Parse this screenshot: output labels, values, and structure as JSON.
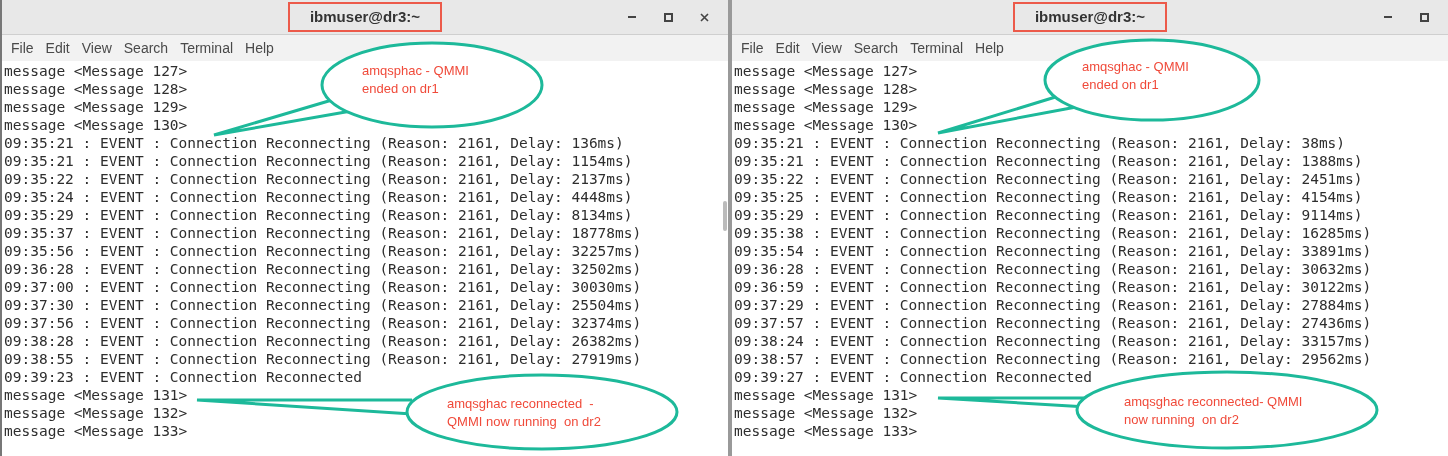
{
  "windows": [
    {
      "title": "ibmuser@dr3:~",
      "controls": [
        {
          "kind": "minimize"
        },
        {
          "kind": "maximize"
        },
        {
          "kind": "close"
        }
      ],
      "menu": [
        "File",
        "Edit",
        "View",
        "Search",
        "Terminal",
        "Help"
      ],
      "lines": [
        "message <Message 127>",
        "message <Message 128>",
        "message <Message 129>",
        "message <Message 130>",
        "09:35:21 : EVENT : Connection Reconnecting (Reason: 2161, Delay: 136ms)",
        "09:35:21 : EVENT : Connection Reconnecting (Reason: 2161, Delay: 1154ms)",
        "09:35:22 : EVENT : Connection Reconnecting (Reason: 2161, Delay: 2137ms)",
        "09:35:24 : EVENT : Connection Reconnecting (Reason: 2161, Delay: 4448ms)",
        "09:35:29 : EVENT : Connection Reconnecting (Reason: 2161, Delay: 8134ms)",
        "09:35:37 : EVENT : Connection Reconnecting (Reason: 2161, Delay: 18778ms)",
        "09:35:56 : EVENT : Connection Reconnecting (Reason: 2161, Delay: 32257ms)",
        "09:36:28 : EVENT : Connection Reconnecting (Reason: 2161, Delay: 32502ms)",
        "09:37:00 : EVENT : Connection Reconnecting (Reason: 2161, Delay: 30030ms)",
        "09:37:30 : EVENT : Connection Reconnecting (Reason: 2161, Delay: 25504ms)",
        "09:37:56 : EVENT : Connection Reconnecting (Reason: 2161, Delay: 32374ms)",
        "09:38:28 : EVENT : Connection Reconnecting (Reason: 2161, Delay: 26382ms)",
        "09:38:55 : EVENT : Connection Reconnecting (Reason: 2161, Delay: 27919ms)",
        "09:39:23 : EVENT : Connection Reconnected",
        "message <Message 131>",
        "message <Message 132>",
        "message <Message 133>"
      ],
      "callouts": [
        {
          "lines": [
            "amqsphac - QMMI",
            "ended on dr1"
          ]
        },
        {
          "lines": [
            "amqsghac reconnected  -",
            "QMMI now running  on dr2"
          ]
        }
      ]
    },
    {
      "title": "ibmuser@dr3:~",
      "controls": [
        {
          "kind": "minimize"
        },
        {
          "kind": "maximize"
        }
      ],
      "menu": [
        "File",
        "Edit",
        "View",
        "Search",
        "Terminal",
        "Help"
      ],
      "lines": [
        "message <Message 127>",
        "message <Message 128>",
        "message <Message 129>",
        "message <Message 130>",
        "09:35:21 : EVENT : Connection Reconnecting (Reason: 2161, Delay: 38ms)",
        "09:35:21 : EVENT : Connection Reconnecting (Reason: 2161, Delay: 1388ms)",
        "09:35:22 : EVENT : Connection Reconnecting (Reason: 2161, Delay: 2451ms)",
        "09:35:25 : EVENT : Connection Reconnecting (Reason: 2161, Delay: 4154ms)",
        "09:35:29 : EVENT : Connection Reconnecting (Reason: 2161, Delay: 9114ms)",
        "09:35:38 : EVENT : Connection Reconnecting (Reason: 2161, Delay: 16285ms)",
        "09:35:54 : EVENT : Connection Reconnecting (Reason: 2161, Delay: 33891ms)",
        "09:36:28 : EVENT : Connection Reconnecting (Reason: 2161, Delay: 30632ms)",
        "09:36:59 : EVENT : Connection Reconnecting (Reason: 2161, Delay: 30122ms)",
        "09:37:29 : EVENT : Connection Reconnecting (Reason: 2161, Delay: 27884ms)",
        "09:37:57 : EVENT : Connection Reconnecting (Reason: 2161, Delay: 27436ms)",
        "09:38:24 : EVENT : Connection Reconnecting (Reason: 2161, Delay: 33157ms)",
        "09:38:57 : EVENT : Connection Reconnecting (Reason: 2161, Delay: 29562ms)",
        "09:39:27 : EVENT : Connection Reconnected",
        "message <Message 131>",
        "message <Message 132>",
        "message <Message 133>"
      ],
      "callouts": [
        {
          "lines": [
            "amqsghac - QMMI",
            "ended on dr1"
          ]
        },
        {
          "lines": [
            "amqsghac reconnected- QMMI",
            "now running  on dr2"
          ]
        }
      ]
    }
  ]
}
